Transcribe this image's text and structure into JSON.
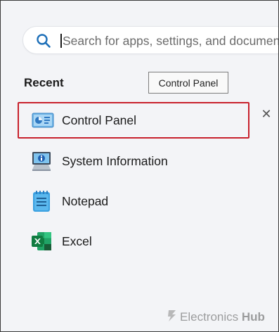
{
  "search": {
    "placeholder": "Search for apps, settings, and documents"
  },
  "recent": {
    "title": "Recent",
    "items": [
      {
        "label": "Control Panel",
        "icon": "control-panel-icon"
      },
      {
        "label": "System Information",
        "icon": "system-information-icon"
      },
      {
        "label": "Notepad",
        "icon": "notepad-icon"
      },
      {
        "label": "Excel",
        "icon": "excel-icon"
      }
    ]
  },
  "tooltip": {
    "text": "Control Panel"
  },
  "close_button": {
    "glyph": "✕"
  },
  "watermark": {
    "prefix": "Electronics",
    "suffix": "Hub"
  },
  "colors": {
    "highlight_border": "#c8212c",
    "background": "#f3f4f7",
    "accent": "#0067c0"
  }
}
